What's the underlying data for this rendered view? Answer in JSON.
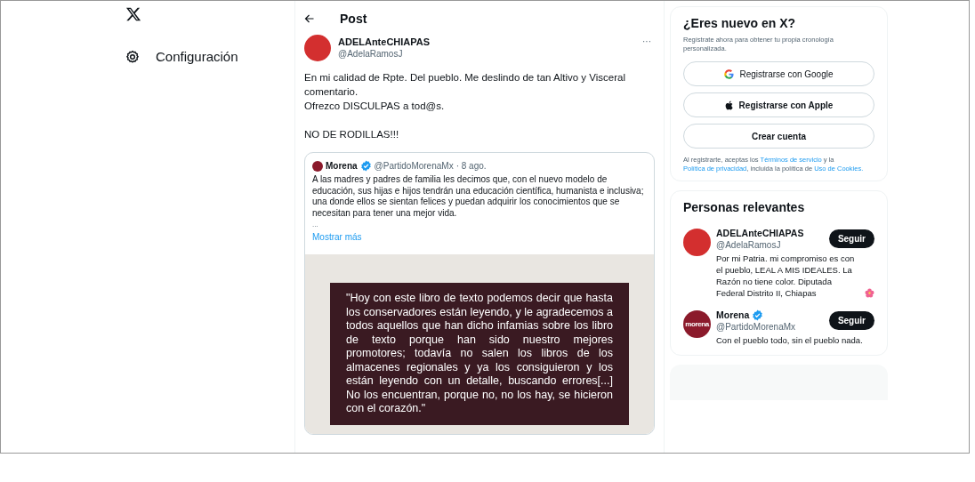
{
  "sidebar": {
    "items": [
      {
        "kind": "settings",
        "label": "Configuración"
      }
    ]
  },
  "post": {
    "header": {
      "title": "Post"
    },
    "author": {
      "name": "ADELAnteCHIAPAS",
      "handle": "@AdelaRamosJ"
    },
    "more": "···",
    "paragraphs": [
      [
        "En mi calidad de Rpte. Del pueblo. Me deslindo de tan Altivo y Visceral comentario.",
        "Ofrezco DISCULPAS a tod@s."
      ],
      [
        "NO DE RODILLAS!!!"
      ]
    ],
    "quote": {
      "name": "Morena",
      "verified": true,
      "handle": "@PartidoMorenaMx",
      "date": "· 8 ago.",
      "text": "A las madres y padres de familia les decimos que, con el nuevo modelo de educación, sus hijas e hijos tendrán una educación científica, humanista e inclusiva; una donde ellos se sientan felices y puedan adquirir los conocimientos que se necesitan para tener una mejor vida.",
      "ellipsis": "...",
      "show_more": "Mostrar más",
      "image_text": "\"Hoy con este libro de texto podemos decir que hasta los conservadores están leyendo, y le agradecemos a todos aquellos que han dicho infamias sobre los libro de texto porque han sido nuestro mejores promotores; todavía no salen los libros de los almacenes regionales y ya los consiguieron y los están leyendo con un detalle, buscando errores[...] No los encuentran, porque no, no los hay, se hicieron con el corazón.\""
    }
  },
  "signup": {
    "title": "¿Eres nuevo en X?",
    "subtitle": "Regístrate ahora para obtener tu propia cronología personalizada.",
    "buttons": [
      {
        "kind": "google",
        "label": "Registrarse con Google"
      },
      {
        "kind": "apple",
        "label": "Registrarse con Apple"
      },
      {
        "kind": "plain",
        "label": "Crear cuenta"
      }
    ],
    "legal": [
      {
        "text": "Al registrarte, aceptas los ",
        "link": false
      },
      {
        "text": "Términos de servicio",
        "link": true
      },
      {
        "text": " y la ",
        "link": false
      },
      {
        "text": "Política de privacidad",
        "link": true
      },
      {
        "text": ", incluida la política de ",
        "link": false
      },
      {
        "text": "Uso de Cookies.",
        "link": true
      }
    ]
  },
  "relevant": {
    "title": "Personas relevantes",
    "people": [
      {
        "name": "ADELAnteCHIAPAS",
        "verified": false,
        "handle": "@AdelaRamosJ",
        "bio": "Por mi Patria. mi compromiso es con el pueblo, LEAL A MIS IDEALES. La Razón no tiene color. Diputada Federal Distrito II, Chiapas",
        "flower": true,
        "button": "Seguir"
      },
      {
        "name": "Morena",
        "verified": true,
        "handle": "@PartidoMorenaMx",
        "bio": "Con el pueblo todo, sin el pueblo nada.",
        "flower": false,
        "button": "Seguir",
        "avatar_text": "morena"
      }
    ]
  }
}
